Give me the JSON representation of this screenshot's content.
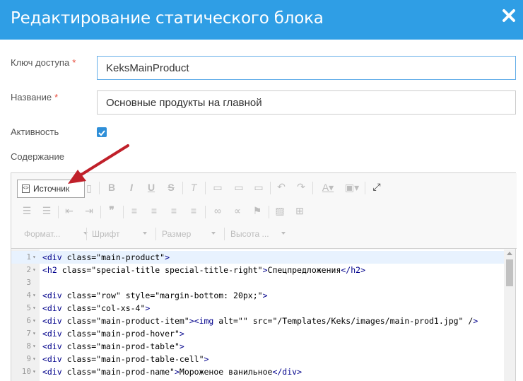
{
  "dialog": {
    "title": "Редактирование статического блока"
  },
  "form": {
    "access_key_label": "Ключ доступа",
    "access_key_value": "KeksMainProduct",
    "name_label": "Название",
    "name_value": "Основные продукты на главной",
    "active_label": "Активность",
    "active_checked": true,
    "content_label": "Содержание",
    "required_mark": "*"
  },
  "editor": {
    "source_button": "Источник",
    "format_label": "Формат...",
    "font_label": "Шрифт",
    "size_label": "Размер",
    "height_label": "Высота ...",
    "lines": [
      {
        "n": "1",
        "fold": "▾",
        "html": "<div class=\"main-product\">"
      },
      {
        "n": "2",
        "fold": "▾",
        "html": "<h2 class=\"special-title special-title-right\">Спецпредложения</h2>"
      },
      {
        "n": "3",
        "fold": "",
        "html": ""
      },
      {
        "n": "4",
        "fold": "▾",
        "html": "<div class=\"row\" style=\"margin-bottom: 20px;\">"
      },
      {
        "n": "5",
        "fold": "▾",
        "html": "<div class=\"col-xs-4\">"
      },
      {
        "n": "6",
        "fold": "▾",
        "html": "<div class=\"main-product-item\"><img alt=\"\" src=\"/Templates/Keks/images/main-prod1.jpg\" />"
      },
      {
        "n": "7",
        "fold": "▾",
        "html": "<div class=\"main-prod-hover\">"
      },
      {
        "n": "8",
        "fold": "▾",
        "html": "<div class=\"main-prod-table\">"
      },
      {
        "n": "9",
        "fold": "▾",
        "html": "<div class=\"main-prod-table-cell\">"
      },
      {
        "n": "10",
        "fold": "▾",
        "html": "<div class=\"main-prod-name\">Мороженое ванильное</div>"
      }
    ]
  },
  "colors": {
    "header": "#2f9ee5",
    "accent": "#2f8fd8",
    "arrow": "#c0202a"
  }
}
